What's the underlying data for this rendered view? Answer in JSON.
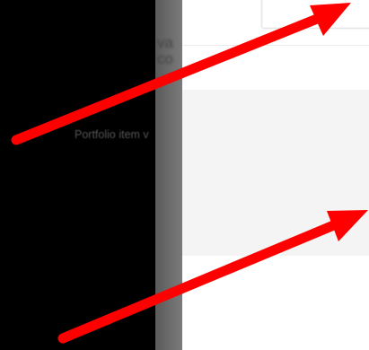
{
  "dialog": {
    "message": "Portfolio item v"
  },
  "background": {
    "ghost_lines": [
      "va",
      "co",
      "",
      "",
      "",
      ""
    ]
  },
  "annotations": {
    "arrow_color": "#ff0000",
    "arrows": [
      "arrow-to-field-box",
      "arrow-to-modal-content"
    ]
  }
}
